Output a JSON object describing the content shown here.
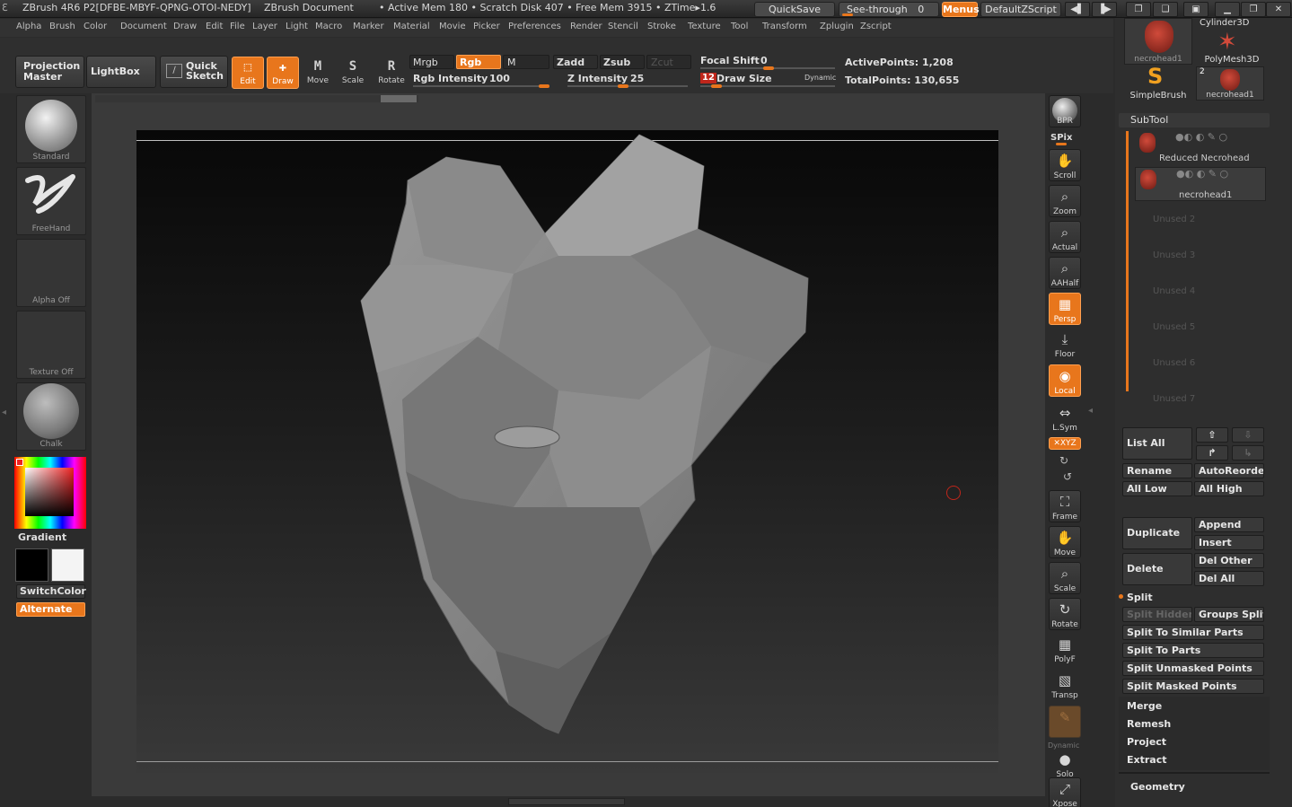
{
  "titlebar": {
    "app": "ZBrush 4R6 P2[DFBE-MBYF-QPNG-OTOI-NEDY]",
    "doc": "ZBrush Document",
    "stats": "• Active Mem 180 • Scratch Disk 407 • Free Mem 3915 • ZTime▸1.6",
    "quicksave": "QuickSave",
    "see_through": "See-through",
    "see_through_val": "0",
    "menus": "Menus",
    "default_zscript": "DefaultZScript"
  },
  "menubar": [
    "Alpha",
    "Brush",
    "Color",
    "Document",
    "Draw",
    "Edit",
    "File",
    "Layer",
    "Light",
    "Macro",
    "Marker",
    "Material",
    "Movie",
    "Picker",
    "Preferences",
    "Render",
    "Stencil",
    "Stroke",
    "Texture",
    "Tool",
    "Transform",
    "Zplugin",
    "Zscript"
  ],
  "toolbar": {
    "projection_master": "Projection Master",
    "lightbox": "LightBox",
    "quick_sketch": "Quick Sketch",
    "edit": "Edit",
    "draw": "Draw",
    "move": "Move",
    "scale": "Scale",
    "rotate": "Rotate",
    "mrgb": "Mrgb",
    "rgb": "Rgb",
    "m": "M",
    "zadd": "Zadd",
    "zsub": "Zsub",
    "zcut": "Zcut",
    "rgb_intensity_label": "Rgb Intensity",
    "rgb_intensity": "100",
    "z_intensity_label": "Z Intensity",
    "z_intensity": "25",
    "focal_shift_label": "Focal Shift",
    "focal_shift": "0",
    "draw_size_label": "Draw Size",
    "draw_size": "12",
    "dynamic": "Dynamic",
    "active_points": "ActivePoints: 1,208",
    "total_points": "TotalPoints: 130,655",
    "accent": "#e8761c"
  },
  "left_tray": {
    "brush": "Standard",
    "stroke": "FreeHand",
    "alpha": "Alpha Off",
    "texture": "Texture Off",
    "material": "Chalk",
    "gradient": "Gradient",
    "switchcolor": "SwitchColor",
    "alternate": "Alternate"
  },
  "right_shelf": {
    "bpr": "BPR",
    "spix": "SPix",
    "scroll": "Scroll",
    "zoom": "Zoom",
    "actual": "Actual",
    "aahalf": "AAHalf",
    "persp": "Persp",
    "floor": "Floor",
    "local": "Local",
    "lsym": "L.Sym",
    "xyz": "✕XYZ",
    "frame": "Frame",
    "move": "Move",
    "scale": "Scale",
    "rotate": "Rotate",
    "polyf": "PolyF",
    "transp": "Transp",
    "dynamic": "Dynamic",
    "solo": "Solo",
    "xpose": "Xpose"
  },
  "tool_thumbs": {
    "t1": "necrohead1",
    "t2": "Cylinder3D",
    "t3": "PolyMesh3D",
    "t4": "SimpleBrush",
    "t5": "necrohead1",
    "t5_count": "2"
  },
  "subtool": {
    "title": "SubTool",
    "items": [
      "Reduced Necrohead",
      "necrohead1"
    ],
    "unused": [
      "Unused 2",
      "Unused 3",
      "Unused 4",
      "Unused 5",
      "Unused 6",
      "Unused 7"
    ],
    "list_all": "List All",
    "rename": "Rename",
    "auto_reorder": "AutoReorder",
    "all_low": "All Low",
    "all_high": "All High",
    "duplicate": "Duplicate",
    "append": "Append",
    "insert": "Insert",
    "delete": "Delete",
    "del_other": "Del Other",
    "del_all": "Del All",
    "split": "Split",
    "split_hidden": "Split Hidden",
    "groups_split": "Groups Split",
    "split_similar": "Split To Similar Parts",
    "split_parts": "Split To Parts",
    "split_unmasked": "Split Unmasked Points",
    "split_masked": "Split Masked Points",
    "merge": "Merge",
    "remesh": "Remesh",
    "project": "Project",
    "extract": "Extract",
    "geometry": "Geometry"
  }
}
